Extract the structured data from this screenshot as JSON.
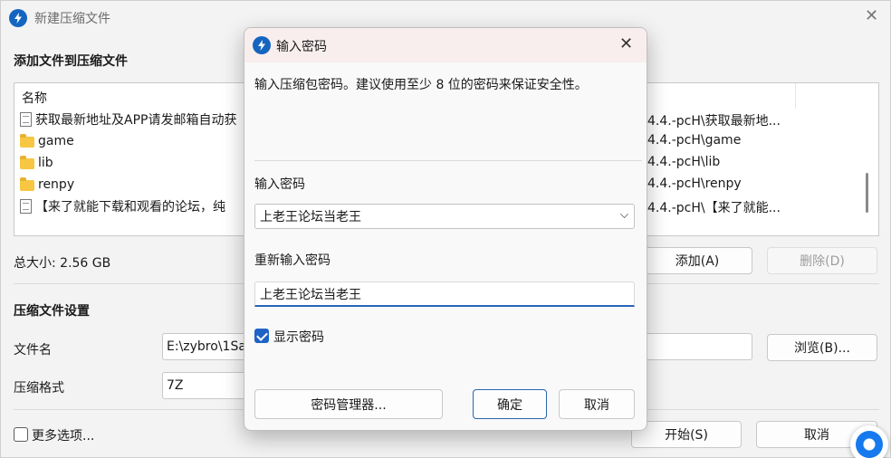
{
  "main": {
    "title": "新建压缩文件",
    "add_section_title": "添加文件到压缩文件",
    "column_name": "名称",
    "files": [
      {
        "name": "获取最新地址及APP请发邮箱自动获",
        "type": "doc",
        "path": "4.4.-pcH\\获取最新地..."
      },
      {
        "name": "game",
        "type": "folder",
        "path": "4.4.-pcH\\game"
      },
      {
        "name": "lib",
        "type": "folder",
        "path": "4.4.-pcH\\lib"
      },
      {
        "name": "renpy",
        "type": "folder",
        "path": "4.4.-pcH\\renpy"
      },
      {
        "name": "【来了就能下载和观看的论坛，纯",
        "type": "doc",
        "path": "4.4.-pcH\\【来了就能..."
      }
    ],
    "total_size": "总大小: 2.56 GB",
    "add_button": "添加(A)",
    "delete_button": "删除(D)",
    "settings_title": "压缩文件设置",
    "filename_label": "文件名",
    "filename_value": "E:\\zybro\\1Sa",
    "browse_button": "浏览(B)...",
    "format_label": "压缩格式",
    "format_value": "7Z",
    "more_options": "更多选项...",
    "start_button": "开始(S)",
    "cancel_button": "取消"
  },
  "dialog": {
    "title": "输入密码",
    "description": "输入压缩包密码。建议使用至少 8 位的密码来保证安全性。",
    "password_label": "输入密码",
    "password_value": "上老王论坛当老王",
    "reenter_label": "重新输入密码",
    "reenter_value": "上老王论坛当老王",
    "show_password_label": "显示密码",
    "show_password_checked": true,
    "manager_button": "密码管理器...",
    "ok_button": "确定",
    "cancel_button": "取消"
  },
  "colors": {
    "accent": "#1f63c6",
    "dialog_title_bg": "#f9eeee"
  }
}
